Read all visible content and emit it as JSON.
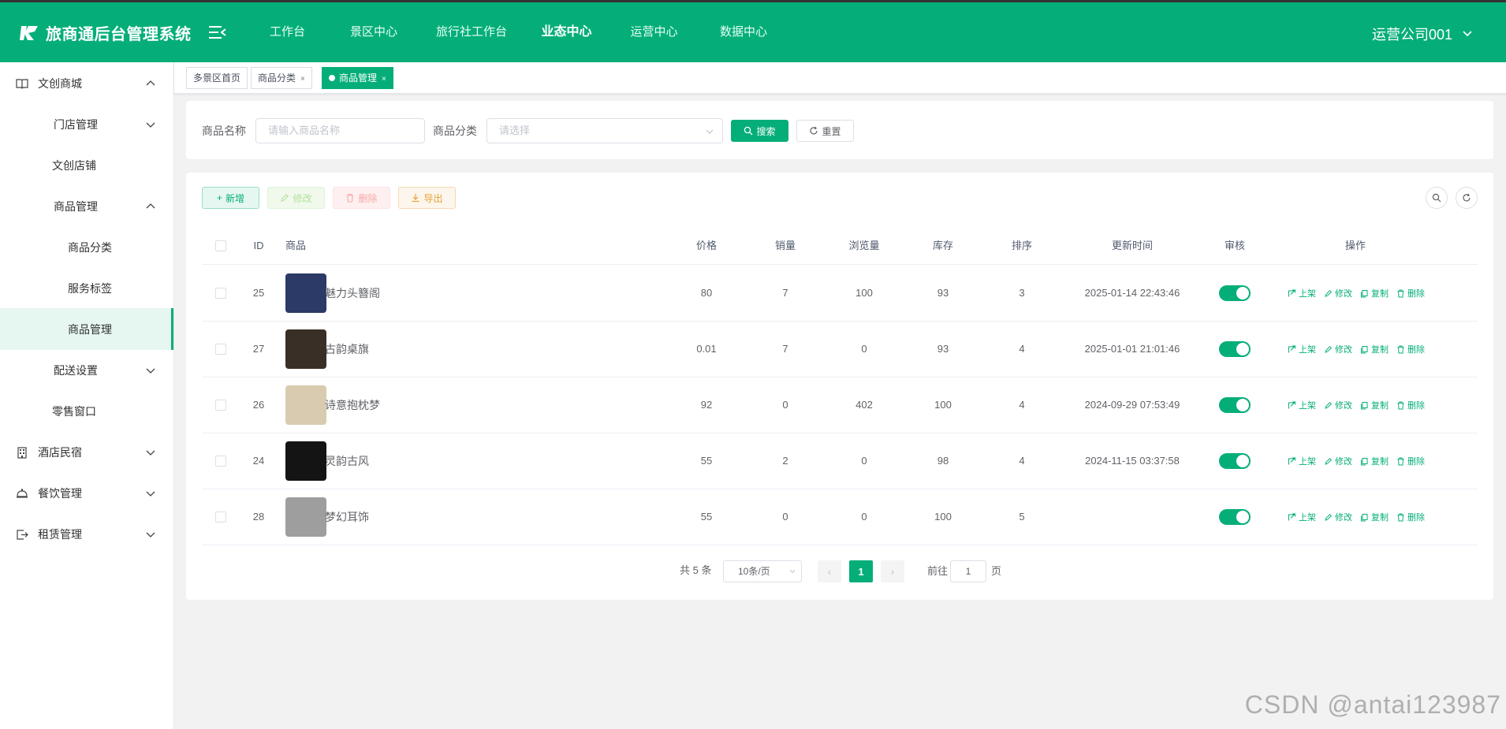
{
  "app": {
    "title": "旅商通后台管理系统"
  },
  "topnav": [
    "工作台",
    "景区中心",
    "旅行社工作台",
    "业态中心",
    "运营中心",
    "数据中心"
  ],
  "account": "运营公司001",
  "sidebar": {
    "items": [
      {
        "label": "文创商城"
      },
      {
        "label": "门店管理"
      },
      {
        "label": "文创店铺"
      },
      {
        "label": "商品管理"
      },
      {
        "label": "商品分类"
      },
      {
        "label": "服务标签"
      },
      {
        "label": "商品管理"
      },
      {
        "label": "配送设置"
      },
      {
        "label": "零售窗口"
      },
      {
        "label": "酒店民宿"
      },
      {
        "label": "餐饮管理"
      },
      {
        "label": "租赁管理"
      }
    ]
  },
  "tags": [
    {
      "label": "多景区首页"
    },
    {
      "label": "商品分类",
      "close": "×"
    },
    {
      "label": "商品管理",
      "close": "×"
    }
  ],
  "search": {
    "name_label": "商品名称",
    "name_placeholder": "请输入商品名称",
    "category_label": "商品分类",
    "category_placeholder": "请选择",
    "search_btn": "搜索",
    "reset_btn": "重置"
  },
  "toolbar": {
    "add": "新增",
    "edit": "修改",
    "delete": "删除",
    "export": "导出"
  },
  "table": {
    "columns": [
      "ID",
      "商品",
      "价格",
      "销量",
      "浏览量",
      "库存",
      "排序",
      "更新时间",
      "审核",
      "操作"
    ],
    "rows": [
      {
        "id": "25",
        "name": "魅力头簪阁",
        "price": "80",
        "sales": "7",
        "views": "100",
        "stock": "93",
        "sort": "3",
        "updated": "2025-01-14 22:43:46",
        "approved": true,
        "thumb_color": "#2b3a66"
      },
      {
        "id": "27",
        "name": "古韵桌旗",
        "price": "0.01",
        "sales": "7",
        "views": "0",
        "stock": "93",
        "sort": "4",
        "updated": "2025-01-01 21:01:46",
        "approved": true,
        "thumb_color": "#3a2f26"
      },
      {
        "id": "26",
        "name": "诗意抱枕梦",
        "price": "92",
        "sales": "0",
        "views": "402",
        "stock": "100",
        "sort": "4",
        "updated": "2024-09-29 07:53:49",
        "approved": true,
        "thumb_color": "#d9cbb0"
      },
      {
        "id": "24",
        "name": "灵韵古风",
        "price": "55",
        "sales": "2",
        "views": "0",
        "stock": "98",
        "sort": "4",
        "updated": "2024-11-15 03:37:58",
        "approved": true,
        "thumb_color": "#141414"
      },
      {
        "id": "28",
        "name": "梦幻耳饰",
        "price": "55",
        "sales": "0",
        "views": "0",
        "stock": "100",
        "sort": "5",
        "updated": "",
        "approved": true,
        "thumb_color": "#9e9e9e"
      }
    ],
    "actions": [
      "上架",
      "修改",
      "复制",
      "删除"
    ]
  },
  "pagination": {
    "total": "共 5 条",
    "page_size": "10条/页",
    "current": "1",
    "goto_label": "前往",
    "goto_value": "1",
    "unit": "页",
    "prev": "‹",
    "next": "›"
  },
  "watermark": "CSDN @antai123987",
  "colors": {
    "primary": "#05ae79"
  }
}
